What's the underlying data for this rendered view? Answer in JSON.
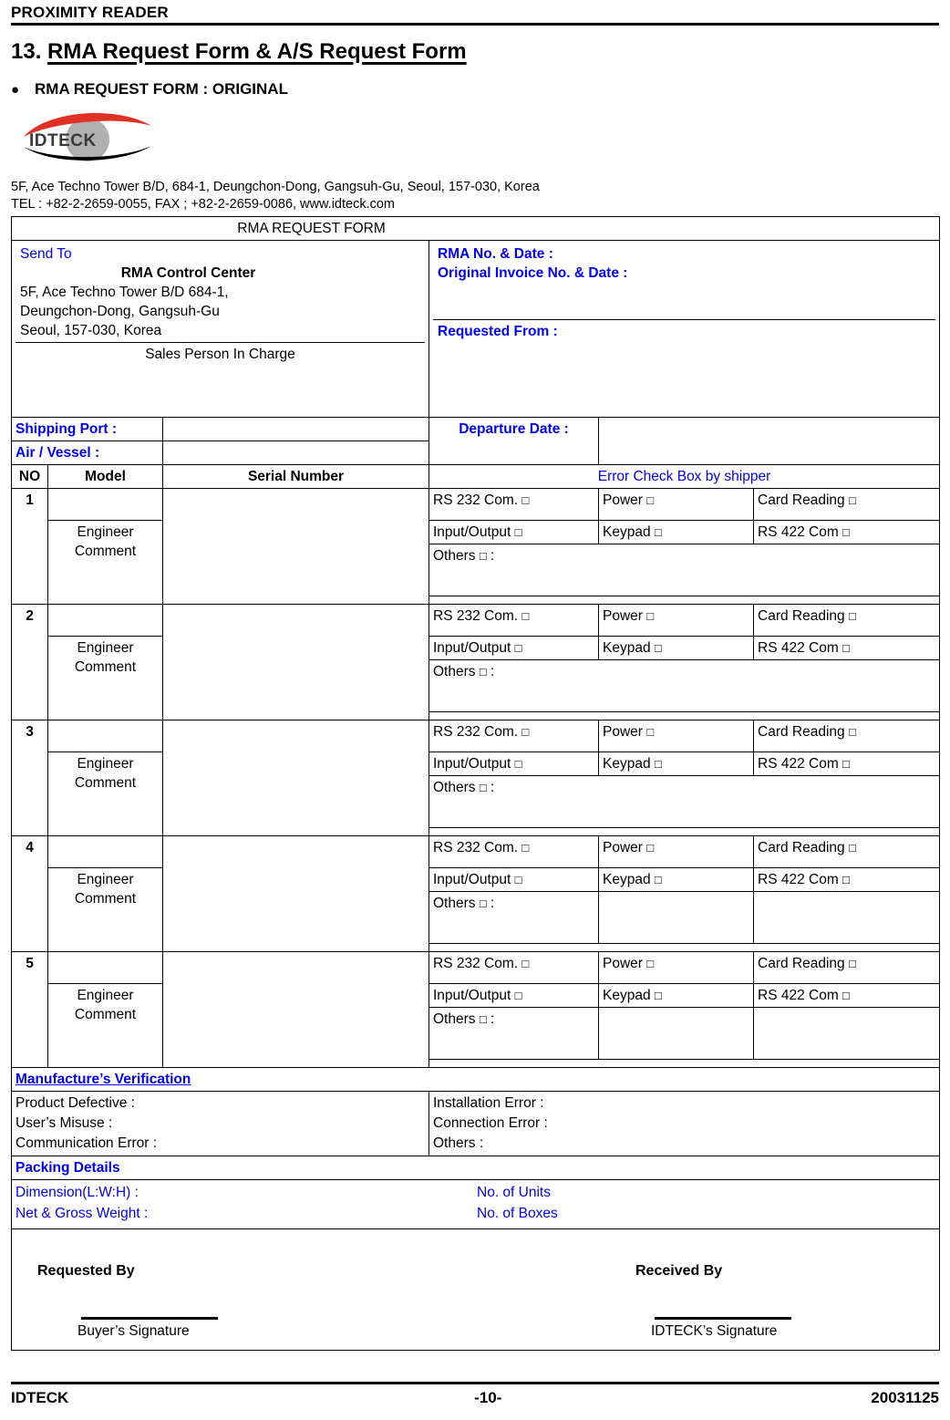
{
  "running_header": {
    "text": "PROXIMITY READER"
  },
  "section": {
    "number": "13.",
    "title": "RMA Request Form & A/S Request Form"
  },
  "bullet": {
    "label": "RMA REQUEST FORM : ORIGINAL"
  },
  "logo": {
    "wordmark": "IDTECK",
    "red": "#e03127",
    "gray": "#b0b0b0",
    "black": "#000000"
  },
  "company": {
    "address": "5F, Ace Techno Tower B/D, 684-1, Deungchon-Dong, Gangsuh-Gu, Seoul, 157-030, Korea",
    "contact": "TEL : +82-2-2659-0055, FAX ; +82-2-2659-0086, www.idteck.com"
  },
  "form": {
    "title": "RMA REQUEST FORM",
    "send_to_label": "Send To",
    "send_to_name": "RMA Control Center",
    "send_to_addr_1": "5F, Ace Techno Tower B/D 684-1,",
    "send_to_addr_2": "Deungchon-Dong, Gangsuh-Gu",
    "send_to_addr_3": "Seoul, 157-030, Korea",
    "sales_person": "Sales Person In Charge",
    "rma_no_date": "RMA No. & Date :",
    "original_invoice": "Original Invoice No. & Date :",
    "requested_from": "Requested From :",
    "shipping_port": "Shipping Port :",
    "air_vessel": "Air / Vessel :",
    "departure_date": "Departure Date :",
    "shipping_port_value": "",
    "air_vessel_value": "",
    "departure_date_value": ""
  },
  "items_header": {
    "no": "NO",
    "model": "Model",
    "serial": "Serial Number",
    "error_check": "Error Check Box by shipper"
  },
  "checkbox_glyph": "□",
  "error_options": {
    "col1": [
      "RS 232 Com.",
      "Input/Output"
    ],
    "col2": [
      "Power",
      "Keypad"
    ],
    "col3": [
      "Card Reading",
      "RS 422 Com"
    ],
    "others": "Others"
  },
  "engineer_comment": "Engineer Comment",
  "items": [
    {
      "no": "1",
      "model": "",
      "serial": "",
      "others_value": "",
      "others_split": false
    },
    {
      "no": "2",
      "model": "",
      "serial": "",
      "others_value": "",
      "others_split": false
    },
    {
      "no": "3",
      "model": "",
      "serial": "",
      "others_value": "",
      "others_split": false
    },
    {
      "no": "4",
      "model": "",
      "serial": "",
      "others_value": "",
      "others_split": true
    },
    {
      "no": "5",
      "model": "",
      "serial": "",
      "others_value": "",
      "others_split": true
    }
  ],
  "verification": {
    "heading": "Manufacture’s Verification",
    "left": [
      "Product Defective :",
      "User’s Misuse :",
      "Communication Error :"
    ],
    "right": [
      "Installation Error :",
      "Connection Error :",
      "Others :"
    ]
  },
  "packing": {
    "heading": "Packing Details",
    "row1_left": "Dimension(L:W:H) :",
    "row1_right": "No. of Units",
    "row2_left": "Net & Gross Weight :",
    "row2_right": "No. of Boxes"
  },
  "signature": {
    "requested_by": "Requested By",
    "received_by": "Received By",
    "buyer_caption": "Buyer’s Signature",
    "idteck_caption": "IDTECK’s Signature"
  },
  "footer": {
    "left": "IDTECK",
    "page": "-10-",
    "right": "20031125"
  },
  "colors": {
    "accent_blue": "#0000ff",
    "text": "#000000"
  }
}
